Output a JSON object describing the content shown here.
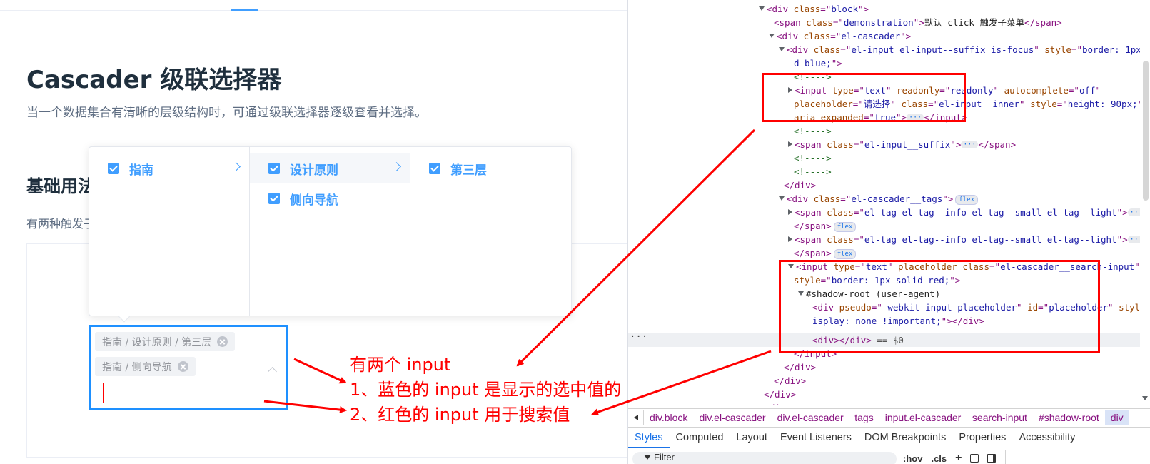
{
  "page": {
    "title": "Cascader 级联选择器",
    "description": "当一个数据集合有清晰的层级结构时，可通过级联选择器逐级查看并选择。",
    "section_title": "基础用法",
    "section_desc": "有两种触发子菜单的方式"
  },
  "cascader": {
    "menus": [
      {
        "items": [
          {
            "label": "指南",
            "checked": true,
            "has_children": true,
            "active": false
          }
        ]
      },
      {
        "items": [
          {
            "label": "设计原则",
            "checked": true,
            "has_children": true,
            "active": true
          },
          {
            "label": "侧向导航",
            "checked": true,
            "has_children": false,
            "active": false
          }
        ]
      },
      {
        "items": [
          {
            "label": "第三层",
            "checked": true,
            "has_children": false,
            "active": false
          }
        ]
      }
    ],
    "tags": [
      "指南 / 设计原则 / 第三层",
      "指南 / 侧向导航"
    ],
    "search_value": ""
  },
  "annotation": {
    "title": "有两个 input",
    "line1": "1、蓝色的 input 是显示的选中值的 input",
    "line2": "2、红色的 input 用于搜索值",
    "color": "#ff0000"
  },
  "devtools": {
    "breadcrumb": [
      "div.block",
      "div.el-cascader",
      "div.el-cascader__tags",
      "input.el-cascader__search-input",
      "#shadow-root",
      "div"
    ],
    "tabs": [
      "Styles",
      "Computed",
      "Layout",
      "Event Listeners",
      "DOM Breakpoints",
      "Properties",
      "Accessibility"
    ],
    "active_tab": "Styles",
    "filter_placeholder": "Filter",
    "filter_tools": [
      ":hov",
      ".cls",
      "+"
    ],
    "pill_flex": "flex",
    "dollar_ref": "== $0"
  },
  "colors": {
    "accent": "#409eff",
    "blue_border": "#1e90ff",
    "red": "#ff0000"
  }
}
